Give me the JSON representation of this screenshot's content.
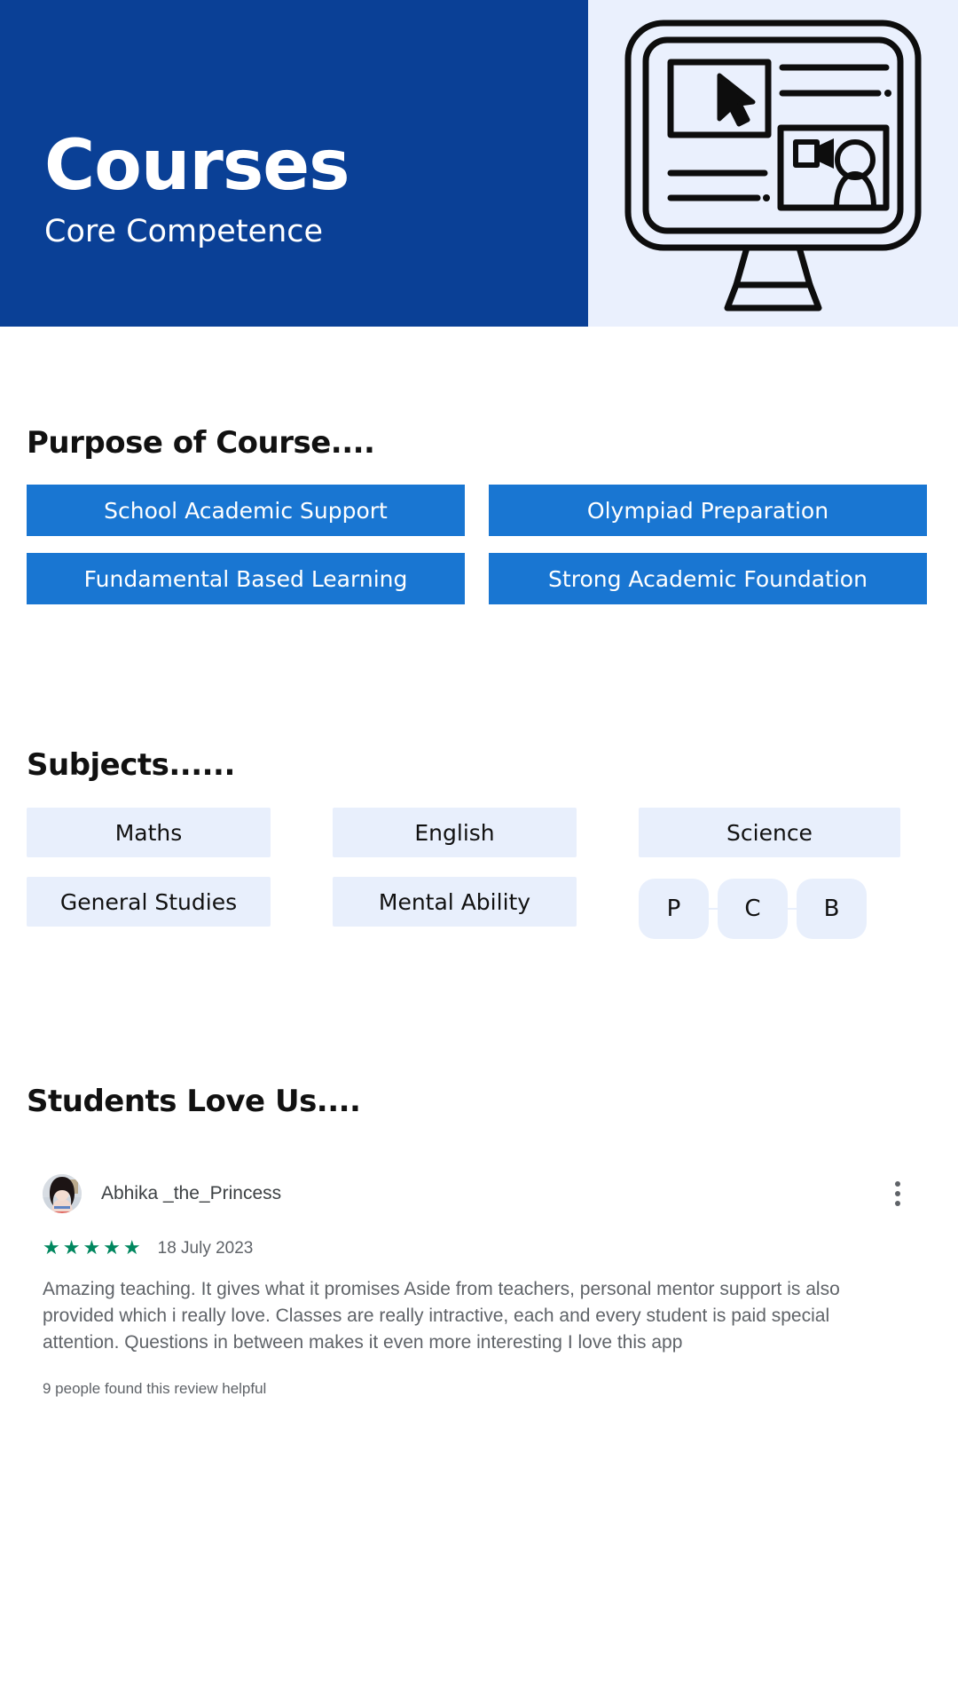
{
  "header": {
    "title": "Courses",
    "subtitle": "Core Competence",
    "illustration_name": "desktop-monitor-elearning-illustration",
    "bg_color": "#0A4096",
    "right_bg_color": "#EAF0FD"
  },
  "purpose": {
    "heading": "Purpose of Course....",
    "accent_color": "#1976D2",
    "items": [
      {
        "label": "School Academic Support"
      },
      {
        "label": "Olympiad Preparation"
      },
      {
        "label": "Fundamental Based Learning"
      },
      {
        "label": "Strong Academic Foundation"
      }
    ]
  },
  "subjects": {
    "heading": "Subjects......",
    "chip_color": "#E8EFFC",
    "items": [
      {
        "label": "Maths"
      },
      {
        "label": "English"
      },
      {
        "label": "Science"
      },
      {
        "label": "General Studies"
      },
      {
        "label": "Mental Ability"
      }
    ],
    "pcb": [
      {
        "label": "P"
      },
      {
        "label": "C"
      },
      {
        "label": "B"
      }
    ]
  },
  "reviews": {
    "heading": "Students Love Us....",
    "star_color": "#01875f",
    "items": [
      {
        "author": "Abhika _the_Princess",
        "avatar_name": "reviewer-avatar",
        "stars": "★★★★★",
        "rating": 5,
        "date": "18 July 2023",
        "text": "Amazing teaching. It gives what it promises Aside from teachers, personal mentor support is also provided which i really love. Classes are really intractive, each and every student is paid special attention. Questions in between makes it even more interesting I love this app",
        "helpful": "9 people found this review helpful",
        "menu_icon": "more-vert-icon"
      }
    ]
  }
}
